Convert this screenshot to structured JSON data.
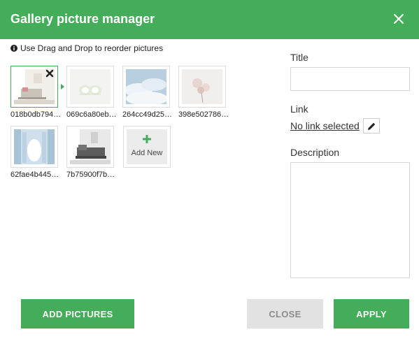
{
  "dialog": {
    "title": "Gallery picture manager",
    "hint": "Use Drag and Drop to reorder pictures"
  },
  "pictures": [
    {
      "caption": "018b0db794…"
    },
    {
      "caption": "069c6a80eb…"
    },
    {
      "caption": "264cc49d25…"
    },
    {
      "caption": "398e502786…"
    },
    {
      "caption": "62fae4b445…"
    },
    {
      "caption": "7b75900f7b…"
    }
  ],
  "add_new": {
    "label": "Add New"
  },
  "form": {
    "title_label": "Title",
    "title_value": "",
    "link_label": "Link",
    "link_value": "No link selected",
    "description_label": "Description",
    "description_value": ""
  },
  "buttons": {
    "add_pictures": "ADD PICTURES",
    "close": "CLOSE",
    "apply": "APPLY"
  },
  "colors": {
    "accent": "#44ad5a",
    "disabled": "#e2e2e2"
  },
  "icons": {
    "close": "close-icon",
    "info": "info-icon",
    "remove": "remove-icon",
    "plus": "plus-icon",
    "edit": "pencil-icon"
  }
}
